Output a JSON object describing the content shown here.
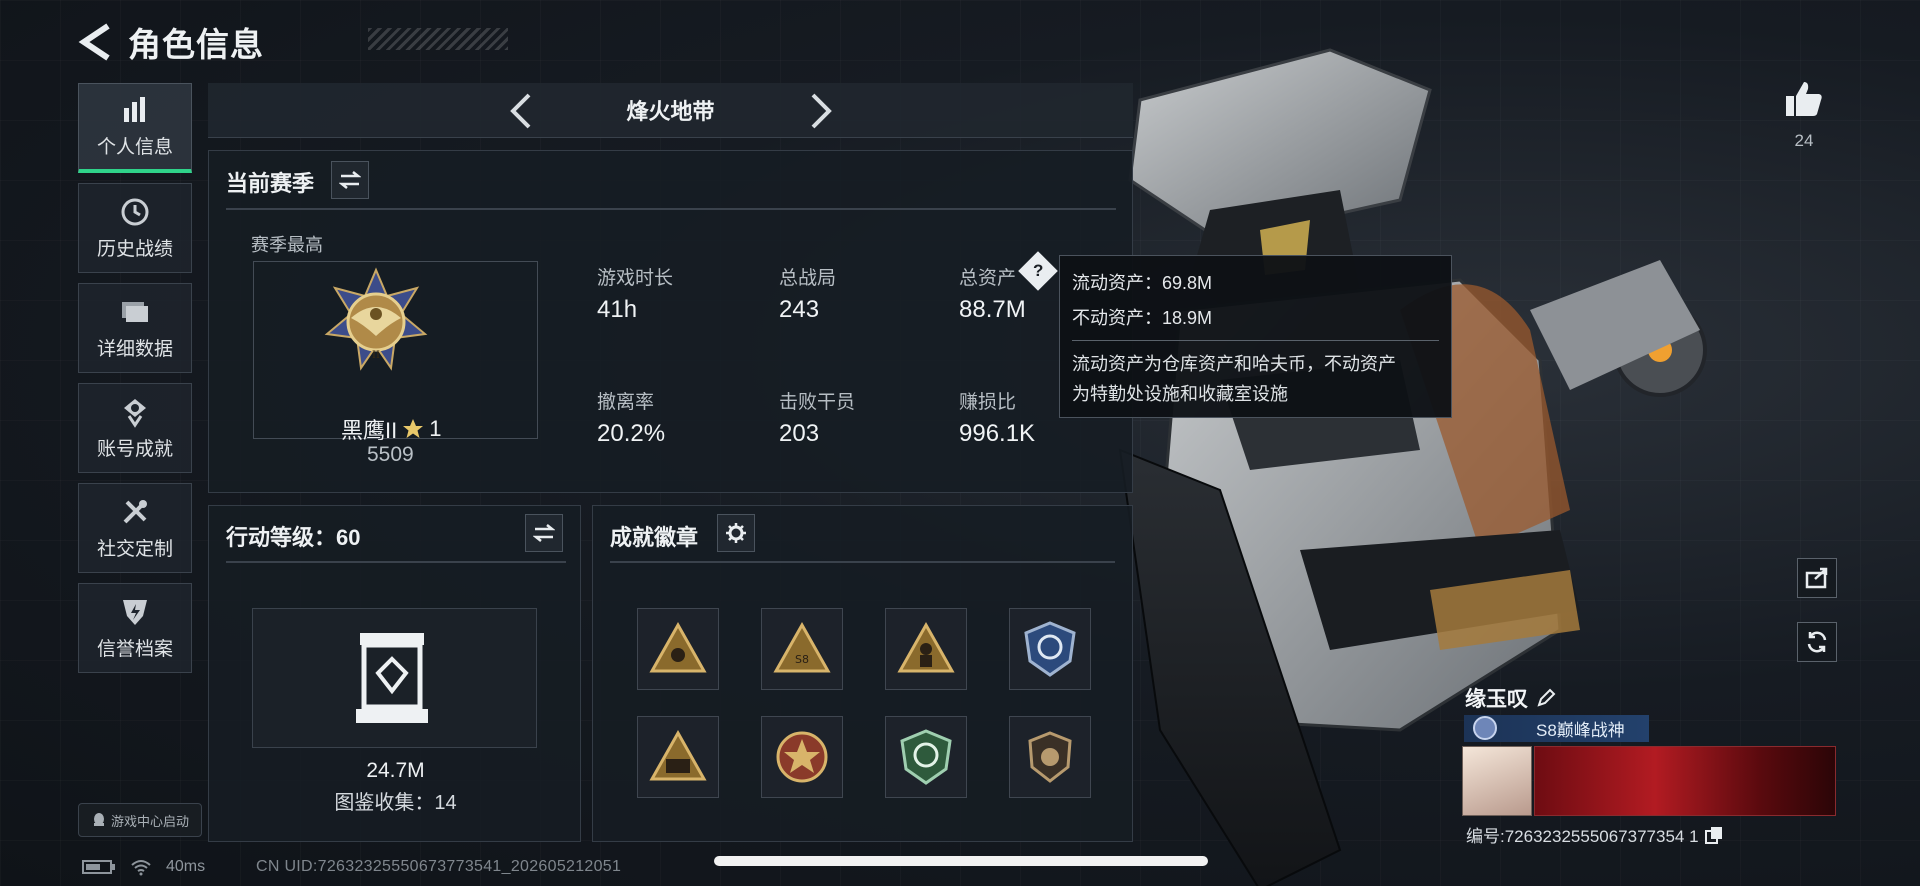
{
  "page": {
    "title": "角色信息"
  },
  "sidebar": {
    "items": [
      {
        "label": "个人信息",
        "icon": "bar-chart-icon",
        "active": true
      },
      {
        "label": "历史战绩",
        "icon": "clock-icon",
        "active": false
      },
      {
        "label": "详细数据",
        "icon": "folder-icon",
        "active": false
      },
      {
        "label": "账号成就",
        "icon": "medal-icon",
        "active": false
      },
      {
        "label": "社交定制",
        "icon": "tools-icon",
        "active": false
      },
      {
        "label": "信誉档案",
        "icon": "shield-bolt-icon",
        "active": false
      }
    ],
    "launcher_label": "游戏中心启动"
  },
  "mode": {
    "title": "烽火地带"
  },
  "season": {
    "title": "当前赛季",
    "best_label": "赛季最高",
    "rank_name": "黑鹰II",
    "rank_star": "1",
    "rank_score": "5509",
    "stats": [
      {
        "label": "游戏时长",
        "value": "41h"
      },
      {
        "label": "总战局",
        "value": "243"
      },
      {
        "label": "总资产",
        "value": "88.7M"
      },
      {
        "label": "撤离率",
        "value": "20.2%"
      },
      {
        "label": "击败干员",
        "value": "203"
      },
      {
        "label": "赚损比",
        "value": "996.1K"
      }
    ]
  },
  "tooltip": {
    "liquid": "流动资产：69.8M",
    "fixed": "不动资产：18.9M",
    "desc1": "流动资产为仓库资产和哈夫币，不动资产",
    "desc2": "为特勤处设施和收藏室设施"
  },
  "level": {
    "title": "行动等级：60",
    "value": "24.7M",
    "collection": "图鉴收集：14"
  },
  "badges": {
    "title": "成就徽章",
    "items": [
      "triangle-badge-icon",
      "triangle-s8-badge-icon",
      "triangle-figure-badge-icon",
      "blue-shield-badge-icon",
      "triangle-squad-badge-icon",
      "star-medal-badge-icon",
      "green-shield-badge-icon",
      "brown-shield-badge-icon"
    ]
  },
  "likes": {
    "count": "24"
  },
  "player": {
    "name": "缘玉叹",
    "title_tag": "S8巅峰战神",
    "id_line": "编号:7263232555067377354 1"
  },
  "status": {
    "ping": "40ms",
    "uid": "CN UID:72632325550673773541_202605212051"
  },
  "colors": {
    "accent_green": "#2fd38a",
    "panel_bg": "#161c23",
    "tag_blue": "#23416c"
  }
}
